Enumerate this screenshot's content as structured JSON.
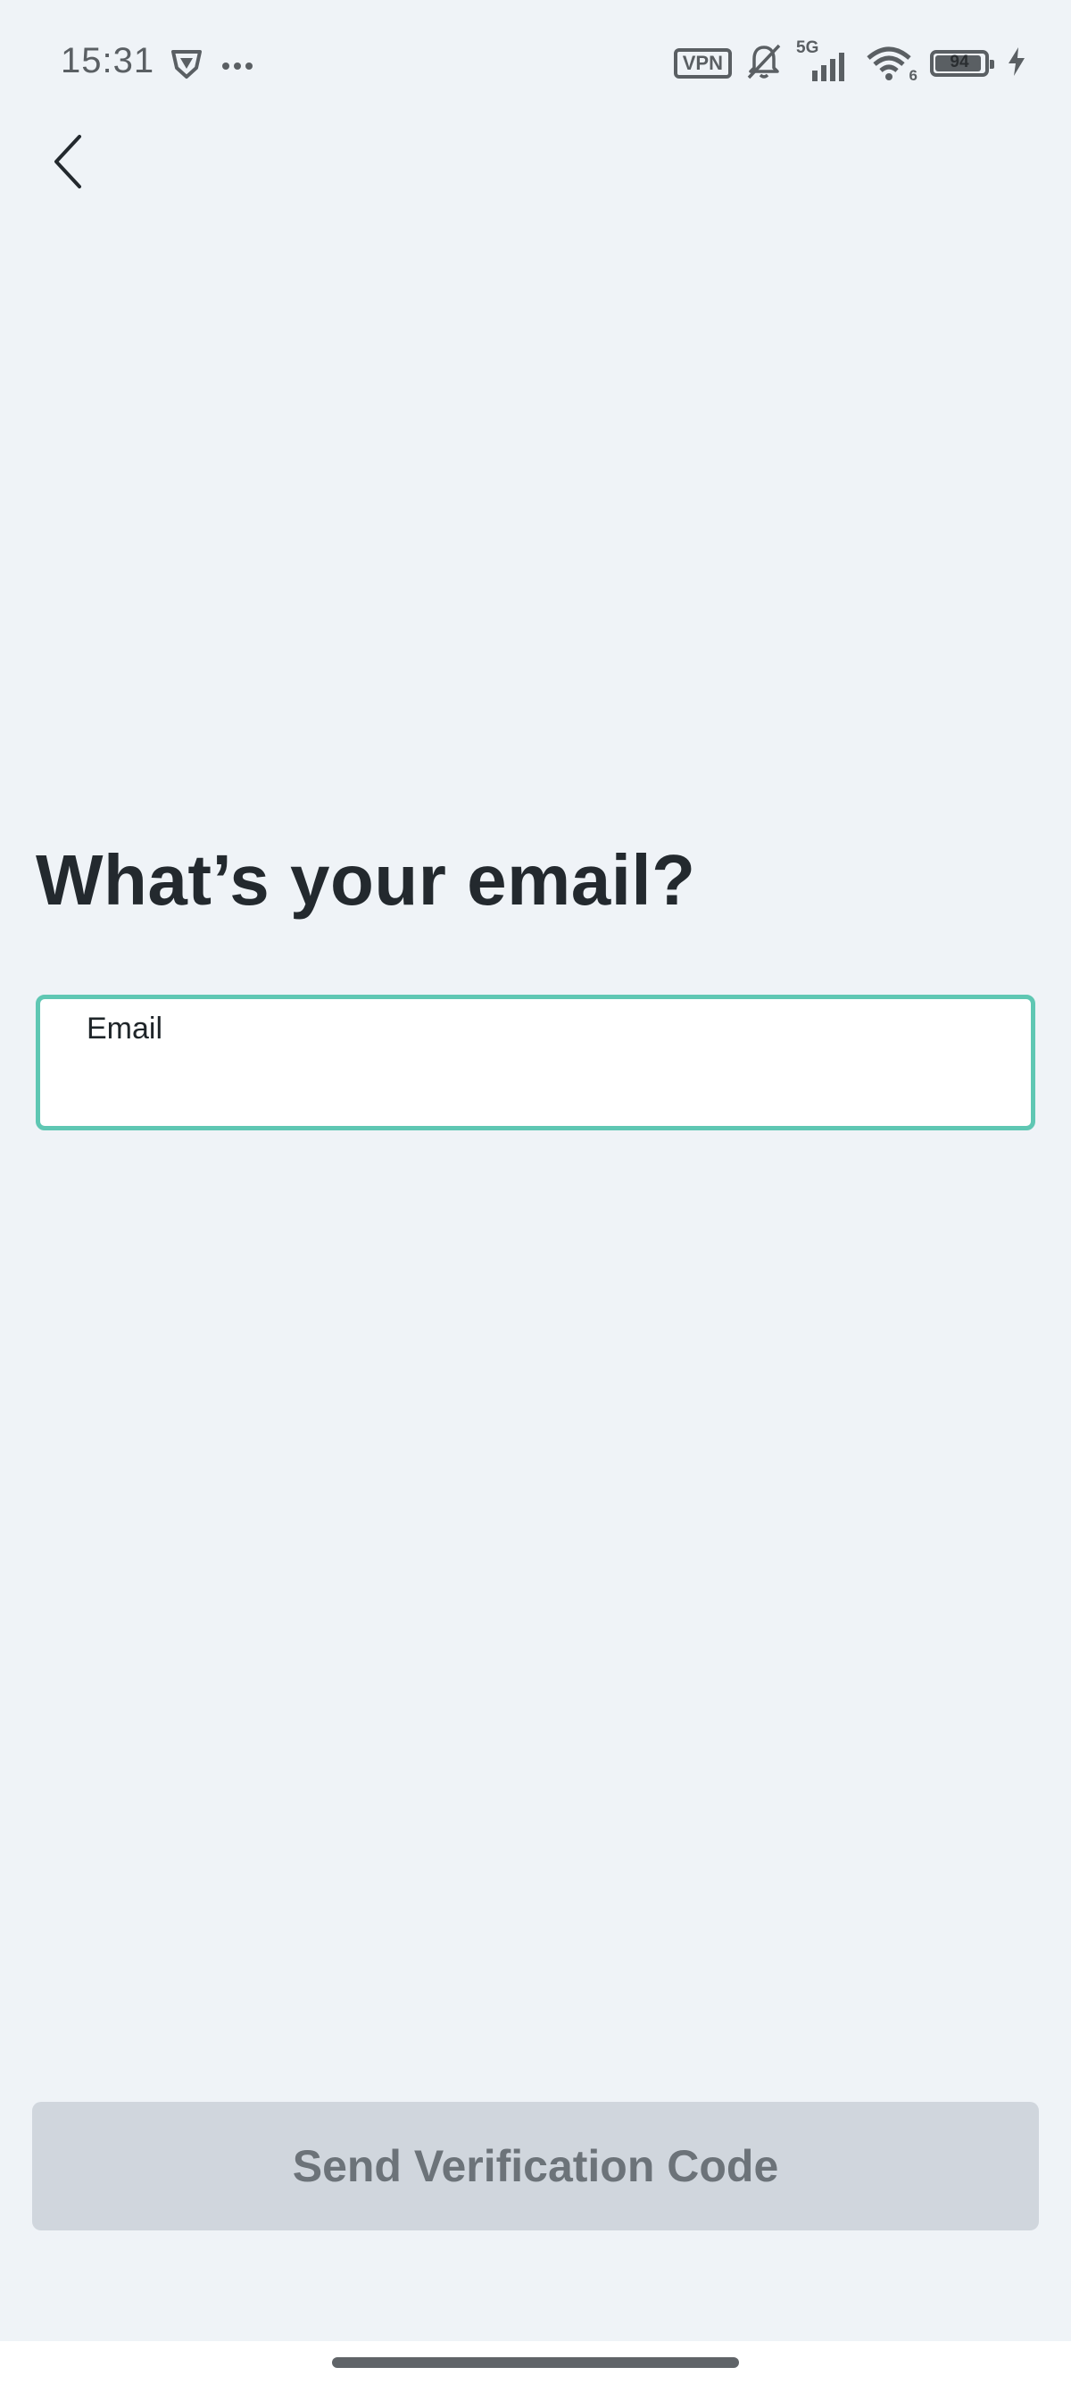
{
  "status_bar": {
    "time": "15:31",
    "vpn_label": "VPN",
    "network_type": "5G",
    "wifi_badge": "6",
    "battery_level": "94",
    "battery_fraction": 0.94,
    "icons": [
      "shield-icon",
      "more-dots-icon",
      "vpn-icon",
      "bell-muted-icon",
      "cellular-signal-icon",
      "wifi-icon",
      "battery-icon",
      "charging-icon"
    ]
  },
  "nav": {
    "back_icon": "chevron-left-icon"
  },
  "main": {
    "title": "What’s your email?",
    "email_field": {
      "label": "Email",
      "value": "",
      "border_color": "#5fc7b3"
    }
  },
  "footer": {
    "send_button_label": "Send Verification Code",
    "send_button_state": "disabled"
  },
  "colors": {
    "background": "#eff3f7",
    "accent": "#5fc7b3",
    "button_disabled": "#d0d6dd",
    "button_text_disabled": "#6c7379",
    "title_text": "#23292e"
  }
}
